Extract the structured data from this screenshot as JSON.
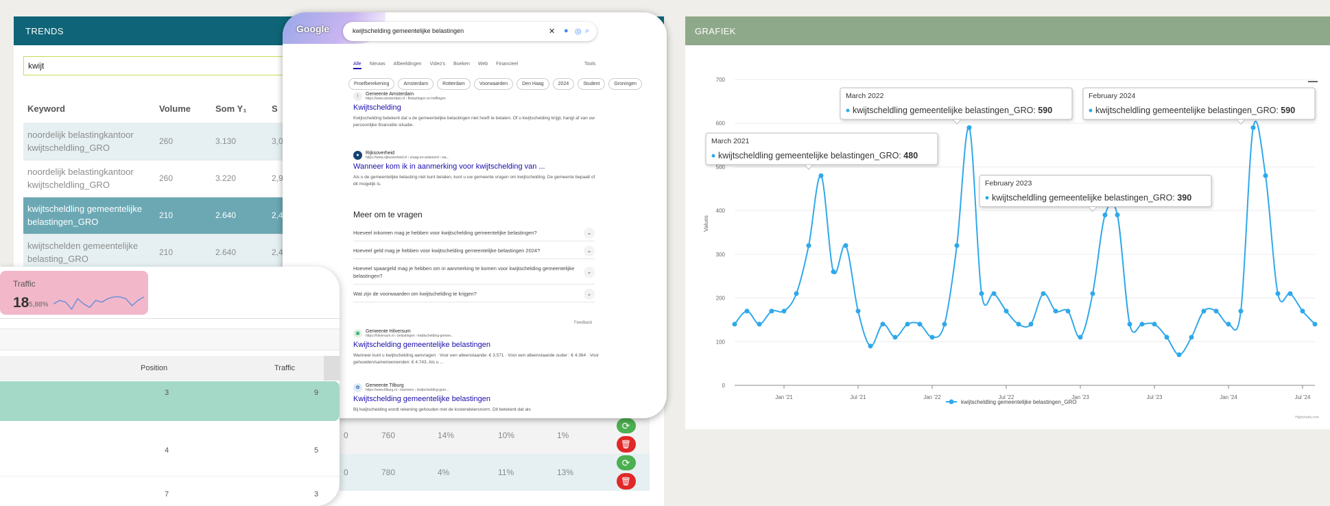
{
  "trends": {
    "title": "TRENDS",
    "search_value": "kwijt",
    "columns": [
      "Keyword",
      "Volume",
      "Som Y₁",
      "S"
    ],
    "rows": [
      {
        "keyword": "noordelijk belastingkantoor kwijtscheldling_GRO",
        "volume": "260",
        "som": "3.130",
        "extra": "3,0"
      },
      {
        "keyword": "noordelijk belastingkantoor kwijtscheldling_GRO",
        "volume": "260",
        "som": "3.220",
        "extra": "2,9"
      },
      {
        "keyword": "kwijtscheldling gemeentelijke belastingen_GRO",
        "volume": "210",
        "som": "2.640",
        "extra": "2,4"
      },
      {
        "keyword": "kwijtschelden gemeentelijke belasting_GRO",
        "volume": "210",
        "som": "2.640",
        "extra": "2,4"
      }
    ],
    "bottom_rows": [
      {
        "c0": "0",
        "c1": "760",
        "c2": "14%",
        "c3": "10%",
        "c4": "1%"
      },
      {
        "c0": "0",
        "c1": "780",
        "c2": "4%",
        "c3": "11%",
        "c4": "13%"
      }
    ]
  },
  "google": {
    "logo": "Google",
    "query": "kwijtschelding gemeentelijke belastingen",
    "tabs": [
      "Alle",
      "Nieuws",
      "Afbeeldingen",
      "Video's",
      "Boeken",
      "Web",
      "Financieel"
    ],
    "tools": "Tools",
    "chips": [
      "Proefberekening",
      "Amsterdam",
      "Rotterdam",
      "Voorwaarden",
      "Den Haag",
      "2024",
      "Student",
      "Groningen"
    ],
    "results": [
      {
        "site": "Gemeente Amsterdam",
        "url": "https://www.amsterdam.nl › Belastingen en heffingen",
        "title": "Kwijtschelding",
        "snippet": "Kwijtschelding betekent dat u de gemeentelijke belastingen niet hoeft te betalen. Of u kwijtschelding krijgt, hangt af van uw persoonlijke financiële situatie."
      },
      {
        "site": "Rijksoverheid",
        "url": "https://www.rijksoverheid.nl › vraag-en-antwoord › wa...",
        "title": "Wanneer kom ik in aanmerking voor kwijtschelding van ...",
        "snippet": "Als u de gemeentelijke belasting niet kunt betalen, kunt u uw gemeente vragen om kwijtschelding. De gemeente bepaalt of dit mogelijk is."
      },
      {
        "site": "Gemeente Hilversum",
        "url": "https://hilversum.nl › belastingen › kwijtschelding-gemee...",
        "title": "Kwijtschelding gemeentelijke belastingen",
        "snippet": "Wanneer kunt u kwijtschelding aanvragen · Voor een alleenstaande: € 3.571 · Voor een alleenstaande ouder : € 4.364 · Voor gehuwden/samenwonenden: € 4.743. Als u ..."
      },
      {
        "site": "Gemeente Tilburg",
        "url": "https://www.tilburg.nl › inwoners › kwijtschelding-gem...",
        "title": "Kwijtschelding gemeentelijke belastingen",
        "snippet": "Bij kwijtschelding wordt rekening gehouden met de kostendelersnorm. Dit betekent dat als"
      }
    ],
    "paa_title": "Meer om te vragen",
    "paa": [
      "Hoeveel inkomen mag je hebben voor kwijtschelding gemeentelijke belastingen?",
      "Hoeveel geld mag je hebben voor kwijtschelding gemeentelijke belastingen 2024?",
      "Hoeveel spaargeld mag je hebben om in aanmerking te komen voor kwijtschelding gemeentelijke belastingen?",
      "Wat zijn de voorwaarden om kwijtschelding te krijgen?"
    ],
    "feedback": "Feedback"
  },
  "traffic": {
    "label": "Traffic",
    "value": "18",
    "change": "5,88%",
    "col_position": "Position",
    "col_traffic": "Traffic",
    "rows": [
      {
        "position": "3",
        "traffic": "9"
      },
      {
        "position": "4",
        "traffic": "5"
      },
      {
        "position": "7",
        "traffic": "3"
      }
    ],
    "sparkline": [
      5,
      7,
      6,
      2,
      8,
      5,
      3,
      7,
      6,
      8,
      9,
      9,
      8,
      4,
      7,
      9
    ]
  },
  "grafiek": {
    "title": "GRAFIEK",
    "credit": "Highcharts.com",
    "colors": {
      "series": "#2fa8ea"
    }
  },
  "chart_data": {
    "type": "line",
    "title": "",
    "xlabel": "",
    "ylabel": "Values",
    "ylim": [
      0,
      700
    ],
    "yticks": [
      0,
      100,
      200,
      300,
      400,
      500,
      600,
      700
    ],
    "xticks": [
      "Jan '21",
      "Jul '21",
      "Jan '22",
      "Jul '22",
      "Jan '23",
      "Jul '23",
      "Jan '24",
      "Jul '24"
    ],
    "x_start": "2020-09",
    "legend": "bottom-center",
    "series": [
      {
        "name": "kwijtscheldling gemeentelijke belastingen_GRO",
        "x": [
          "2020-09",
          "2020-10",
          "2020-11",
          "2020-12",
          "2021-01",
          "2021-02",
          "2021-03",
          "2021-04",
          "2021-05",
          "2021-06",
          "2021-07",
          "2021-08",
          "2021-09",
          "2021-10",
          "2021-11",
          "2021-12",
          "2022-01",
          "2022-02",
          "2022-03",
          "2022-04",
          "2022-05",
          "2022-06",
          "2022-07",
          "2022-08",
          "2022-09",
          "2022-10",
          "2022-11",
          "2022-12",
          "2023-01",
          "2023-02",
          "2023-03",
          "2023-04",
          "2023-05",
          "2023-06",
          "2023-07",
          "2023-08",
          "2023-09",
          "2023-10",
          "2023-11",
          "2023-12",
          "2024-01",
          "2024-02",
          "2024-03",
          "2024-04",
          "2024-05",
          "2024-06",
          "2024-07",
          "2024-08"
        ],
        "values": [
          140,
          170,
          140,
          170,
          170,
          210,
          320,
          480,
          260,
          320,
          170,
          90,
          140,
          110,
          140,
          140,
          110,
          140,
          320,
          590,
          210,
          210,
          170,
          140,
          140,
          210,
          170,
          170,
          110,
          210,
          390,
          390,
          140,
          140,
          140,
          110,
          70,
          110,
          170,
          170,
          140,
          170,
          590,
          480,
          210,
          210,
          170,
          140
        ]
      }
    ],
    "tooltips": [
      {
        "label": "March 2021",
        "series": "kwijtscheldling gemeentelijke belastingen_GRO",
        "value": "480"
      },
      {
        "label": "March 2022",
        "series": "kwijtscheldling gemeentelijke belastingen_GRO",
        "value": "590"
      },
      {
        "label": "February 2023",
        "series": "kwijtscheldling gemeentelijke belastingen_GRO",
        "value": "390"
      },
      {
        "label": "February 2024",
        "series": "kwijtscheldling gemeentelijke belastingen_GRO",
        "value": "590"
      }
    ]
  }
}
